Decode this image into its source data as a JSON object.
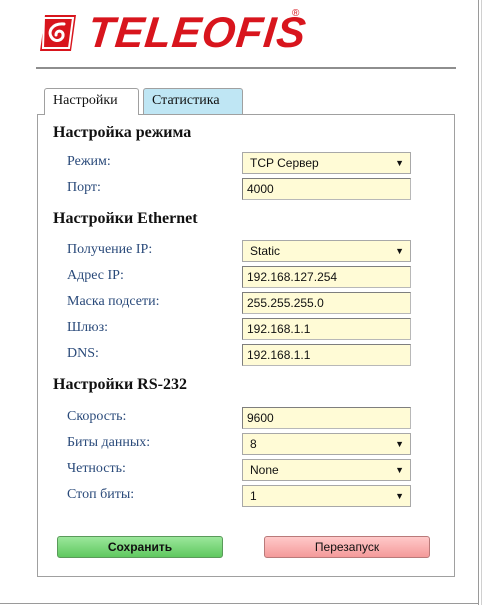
{
  "brand": {
    "name": "TELEOFIS",
    "reg_mark": "®",
    "color": "#d8151d"
  },
  "tabs": [
    {
      "label": "Настройки",
      "active": true
    },
    {
      "label": "Статистика",
      "active": false
    }
  ],
  "mode_section": {
    "title": "Настройка режима",
    "mode": {
      "label": "Режим:",
      "value": "TCP Сервер"
    },
    "port": {
      "label": "Порт:",
      "value": "4000"
    }
  },
  "ethernet_section": {
    "title": "Настройки Ethernet",
    "ip_mode": {
      "label": "Получение IP:",
      "value": "Static"
    },
    "ip": {
      "label": "Адрес IP:",
      "value": "192.168.127.254"
    },
    "mask": {
      "label": "Маска подсети:",
      "value": "255.255.255.0"
    },
    "gateway": {
      "label": "Шлюз:",
      "value": "192.168.1.1"
    },
    "dns": {
      "label": "DNS:",
      "value": "192.168.1.1"
    }
  },
  "rs232_section": {
    "title": "Настройки RS-232",
    "speed": {
      "label": "Скорость:",
      "value": "9600"
    },
    "data_bits": {
      "label": "Биты данных:",
      "value": "8"
    },
    "parity": {
      "label": "Четность:",
      "value": "None"
    },
    "stop_bits": {
      "label": "Стоп биты:",
      "value": "1"
    }
  },
  "buttons": {
    "save": "Сохранить",
    "restart": "Перезапуск"
  },
  "icons": {
    "dropdown": "▼"
  },
  "colors": {
    "tab_inactive": "#bfe6f4",
    "input_bg": "#fffbd6",
    "save": "#7dd87d",
    "restart": "#f7b0b0"
  }
}
